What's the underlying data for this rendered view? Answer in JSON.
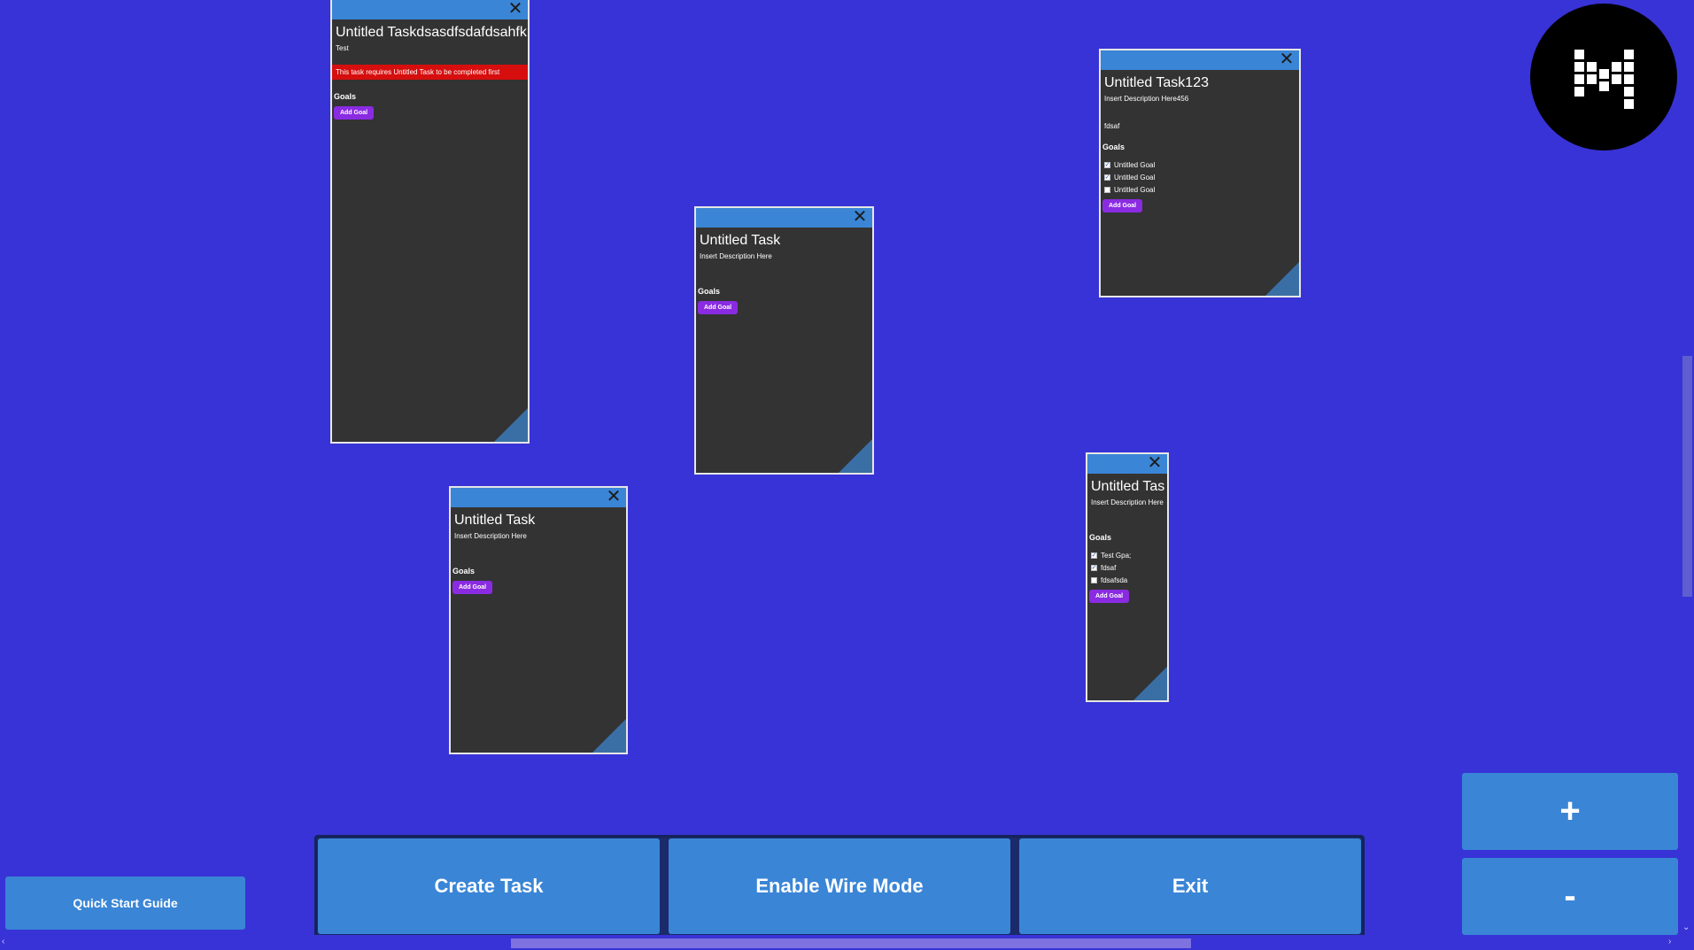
{
  "tasks": [
    {
      "title": "Untitled Taskdsasdfsdafdsahfk",
      "description": "Test",
      "warning": "This task requires Untitled Task to be completed first",
      "goals_heading": "Goals",
      "goals": [],
      "add_goal_label": "Add Goal",
      "close_label": "✕"
    },
    {
      "title": "Untitled Task",
      "description": "Insert Description Here",
      "goals_heading": "Goals",
      "goals": [],
      "add_goal_label": "Add Goal",
      "close_label": "✕"
    },
    {
      "title": "Untitled Task123",
      "description": "Insert Description Here456",
      "extra_text": "fdsaf",
      "goals_heading": "Goals",
      "goals": [
        {
          "label": "Untitled Goal",
          "checked": true
        },
        {
          "label": "Untitled Goal",
          "checked": true
        },
        {
          "label": "Untitled Goal",
          "checked": false
        }
      ],
      "add_goal_label": "Add Goal",
      "close_label": "✕"
    },
    {
      "title": "Untitled Task",
      "description": "Insert Description Here",
      "goals_heading": "Goals",
      "goals": [],
      "add_goal_label": "Add Goal",
      "close_label": "✕"
    },
    {
      "title": "Untitled Tas",
      "description": "Insert Description Here",
      "goals_heading": "Goals",
      "goals": [
        {
          "label": "Test Gpa;",
          "checked": true
        },
        {
          "label": "fdsaf",
          "checked": true
        },
        {
          "label": "fdsafsda",
          "checked": false
        }
      ],
      "add_goal_label": "Add Goal",
      "close_label": "✕"
    }
  ],
  "toolbar": {
    "create_task_label": "Create Task",
    "wire_mode_label": "Enable Wire Mode",
    "exit_label": "Exit"
  },
  "quick_start_label": "Quick Start Guide",
  "zoom": {
    "in_label": "+",
    "out_label": "-"
  },
  "colors": {
    "background": "#3833d6",
    "card": "#333333",
    "header": "#3a85d6",
    "warning": "#d60e0e",
    "add_goal": "#8a2be2"
  }
}
